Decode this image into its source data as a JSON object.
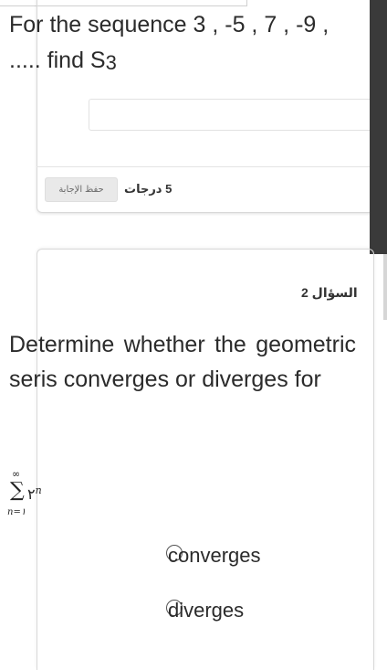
{
  "question1": {
    "text": "For the sequence 3 , -5 , 7 , -9 ,",
    "text_line2": "..... find S",
    "subscript": "3",
    "save_button": "حفظ الإجابة",
    "points": "5 درجات"
  },
  "question2": {
    "number_label": "السؤال 2",
    "text": "Determine whether the geometric seris converges or diverges for",
    "math": {
      "upper": "∞",
      "sigma": "∑",
      "base": "۲",
      "exponent": "n",
      "lower": "n=١"
    },
    "options": [
      {
        "label": "converges"
      },
      {
        "label": "diverges"
      }
    ]
  }
}
